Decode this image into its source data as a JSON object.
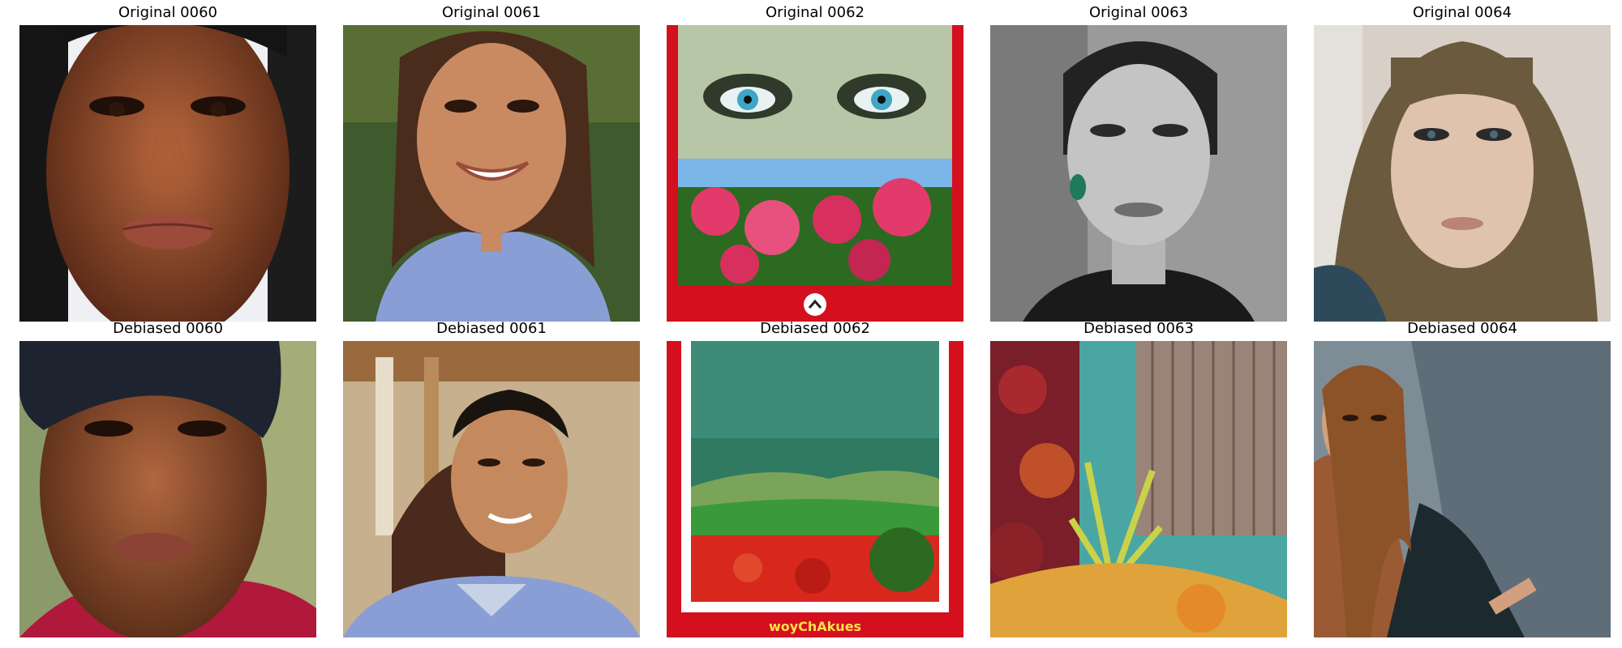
{
  "panels": {
    "original": [
      {
        "title": "Original 0060"
      },
      {
        "title": "Original 0061"
      },
      {
        "title": "Original 0062"
      },
      {
        "title": "Original 0063"
      },
      {
        "title": "Original 0064"
      }
    ],
    "debiased": [
      {
        "title": "Debiased 0060"
      },
      {
        "title": "Debiased 0061"
      },
      {
        "title": "Debiased 0062",
        "caption": "woyChAkues"
      },
      {
        "title": "Debiased 0063"
      },
      {
        "title": "Debiased 0064"
      }
    ]
  },
  "colors": {
    "skin_dark": "#8a4a2c",
    "skin_tan": "#c98a62",
    "poster_red": "#d40f1e",
    "flower_pink": "#e23a6a",
    "grayscale": "#8a8a8a",
    "scarf_red": "#b0183c",
    "sweater_blue": "#8a9ed6"
  }
}
